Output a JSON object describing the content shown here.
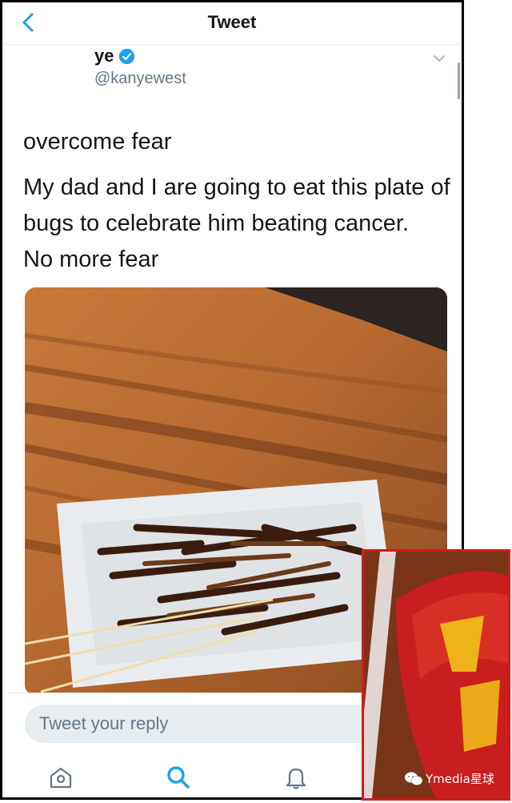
{
  "nav": {
    "title": "Tweet"
  },
  "author": {
    "name": "ye",
    "handle": "@kanyewest"
  },
  "tweet": {
    "line1": "overcome fear",
    "line2": "My dad and I are going to eat this plate of bugs to celebrate him beating cancer.",
    "line3": "No more fear"
  },
  "reply": {
    "placeholder": "Tweet your reply"
  },
  "tabs": [
    "home-icon",
    "search-icon",
    "notifications-icon"
  ],
  "watermark": {
    "text": "Ymedia星球"
  },
  "colors": {
    "accent": "#1da1f2",
    "verified": "#1da1f2",
    "inset_border": "#d21a1a"
  }
}
